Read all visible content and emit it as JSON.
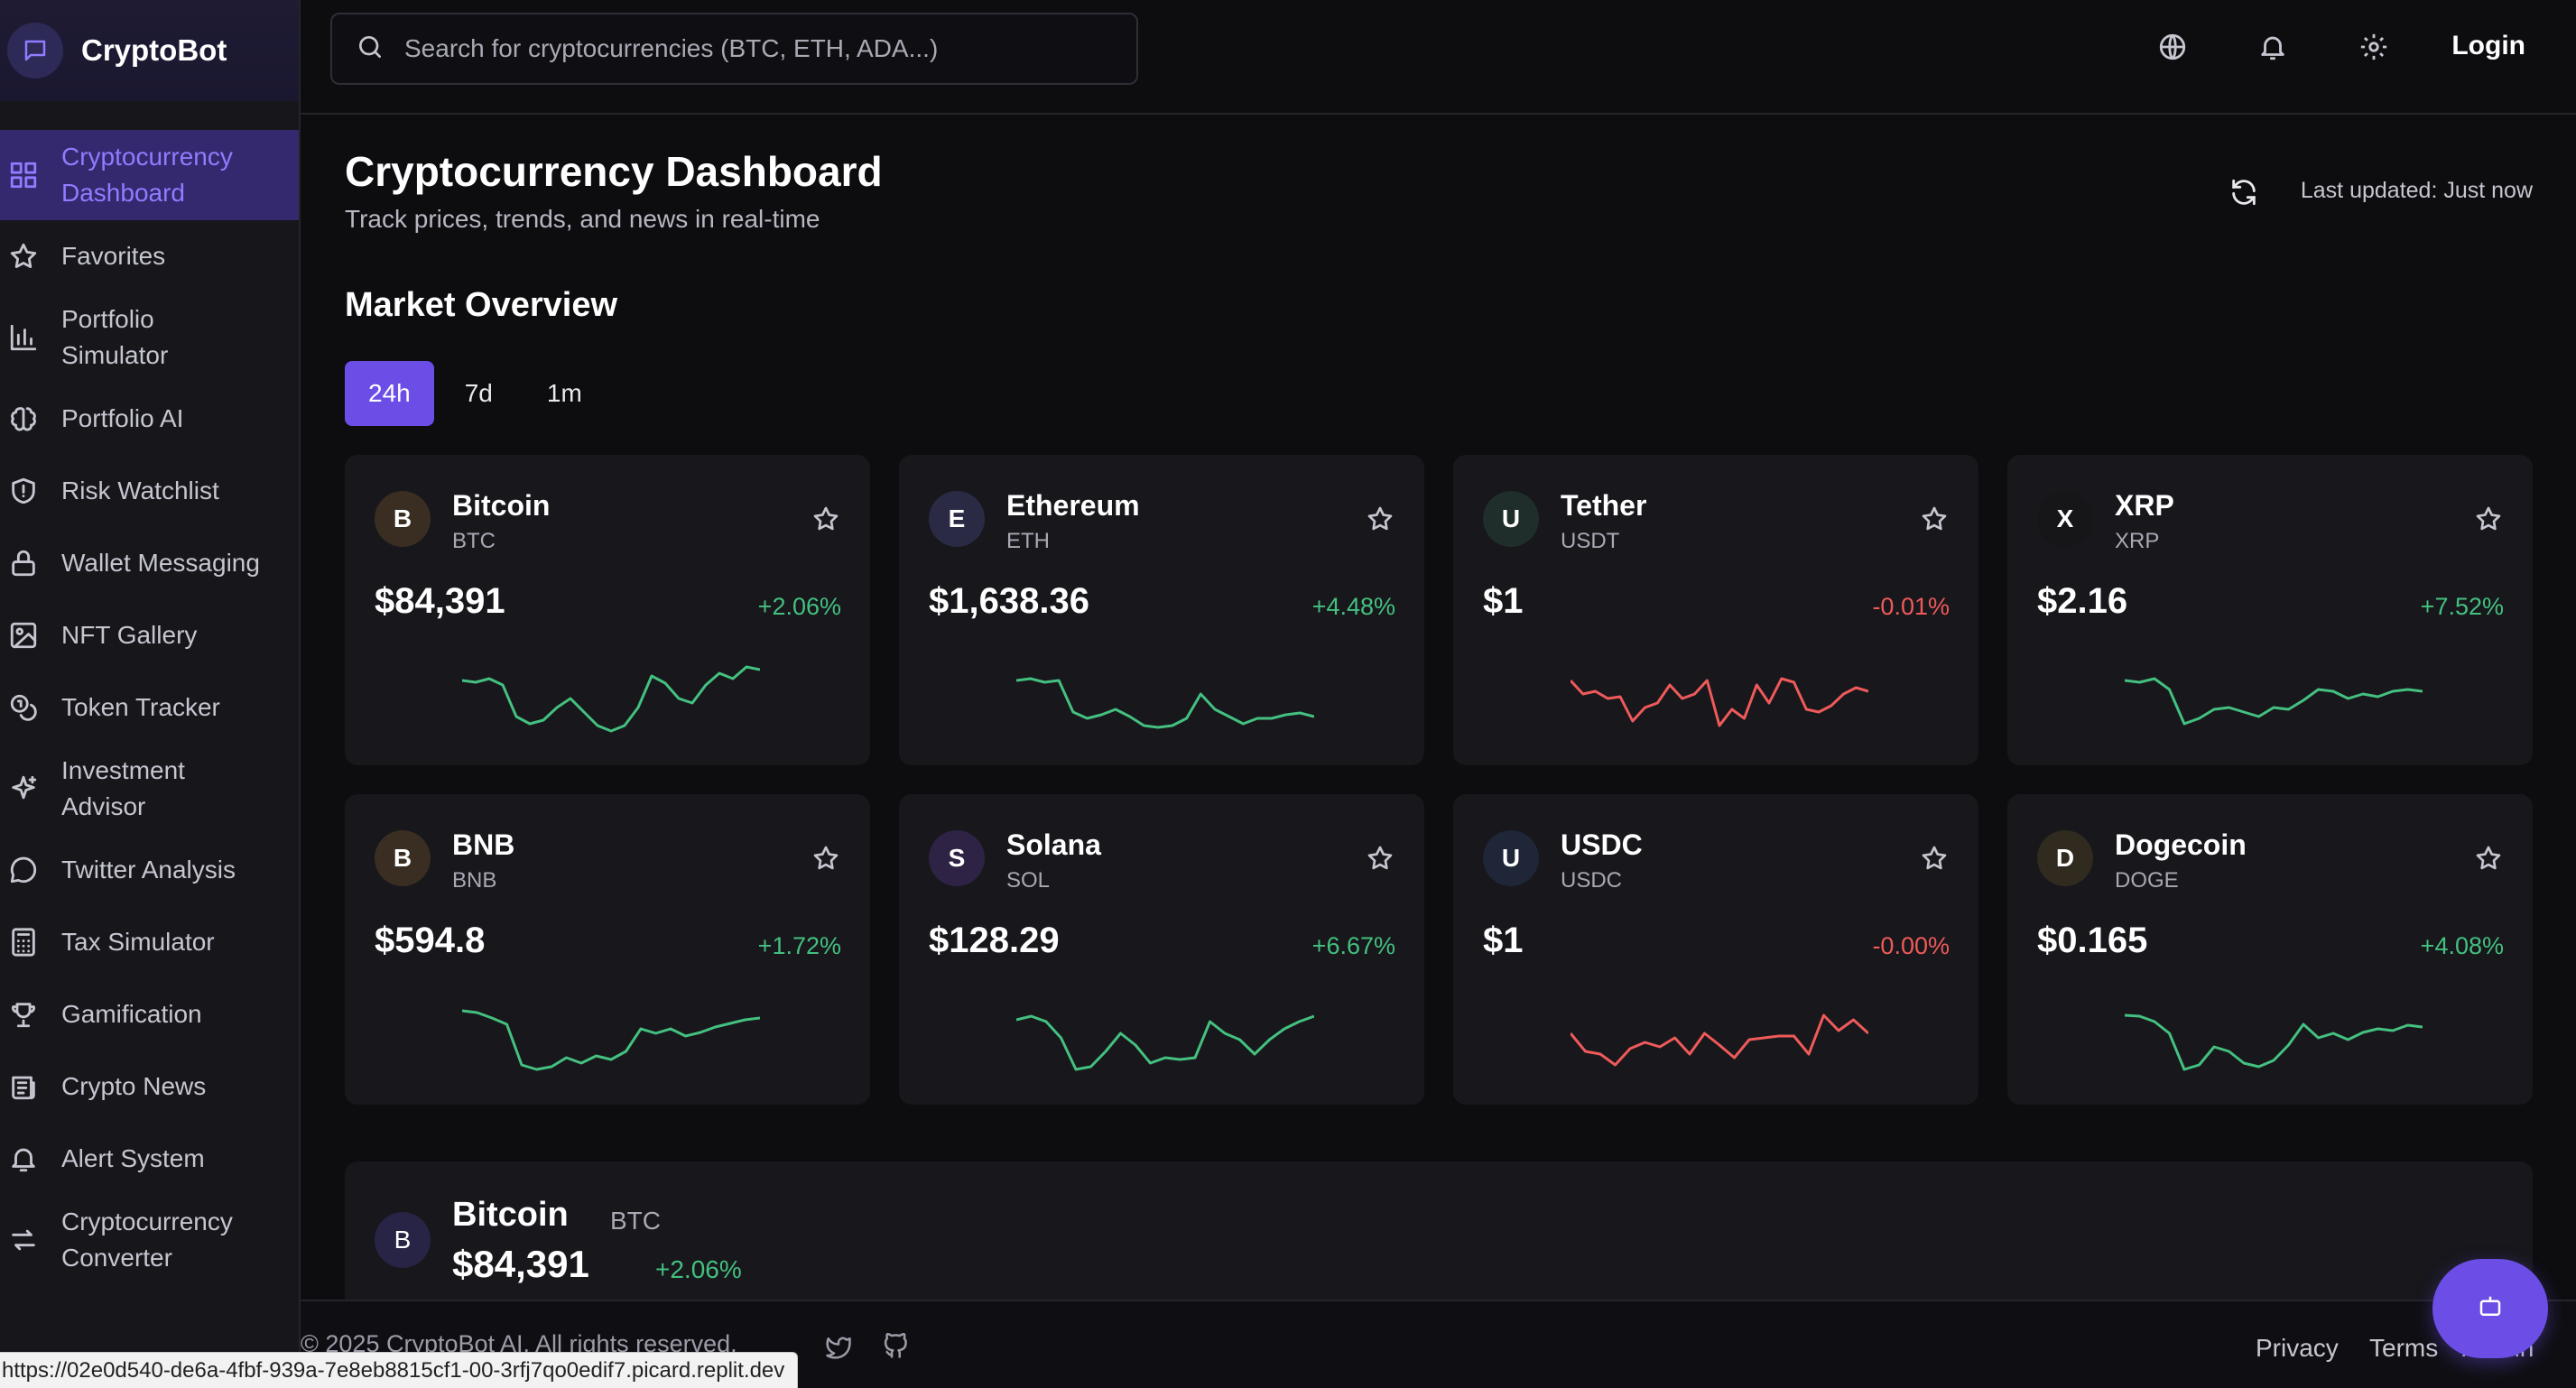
{
  "app": {
    "name": "CryptoBot",
    "brand_icon": "chat-bubble-icon"
  },
  "sidebar": {
    "items": [
      {
        "label": "Cryptocurrency\nDashboard",
        "icon": "grid-icon",
        "active": true
      },
      {
        "label": "Favorites",
        "icon": "star-icon"
      },
      {
        "label": "Portfolio\nSimulator",
        "icon": "bar-chart-icon"
      },
      {
        "label": "Portfolio AI",
        "icon": "brain-icon"
      },
      {
        "label": "Risk Watchlist",
        "icon": "shield-icon"
      },
      {
        "label": "Wallet Messaging",
        "icon": "lock-icon"
      },
      {
        "label": "NFT Gallery",
        "icon": "image-icon"
      },
      {
        "label": "Token Tracker",
        "icon": "coins-icon"
      },
      {
        "label": "Investment\nAdvisor",
        "icon": "sparkles-icon"
      },
      {
        "label": "Twitter Analysis",
        "icon": "message-circle-icon"
      },
      {
        "label": "Tax Simulator",
        "icon": "calculator-icon"
      },
      {
        "label": "Gamification",
        "icon": "trophy-icon"
      },
      {
        "label": "Crypto News",
        "icon": "newspaper-icon"
      },
      {
        "label": "Alert System",
        "icon": "bell-icon"
      },
      {
        "label": "Cryptocurrency\nConverter",
        "icon": "swap-icon"
      }
    ]
  },
  "topbar": {
    "search_placeholder": "Search for cryptocurrencies (BTC, ETH, ADA...)",
    "search_value": "",
    "login_label": "Login"
  },
  "header": {
    "title": "Cryptocurrency Dashboard",
    "subtitle": "Track prices, trends, and news in real-time",
    "last_updated": "Last updated: Just now"
  },
  "market": {
    "title": "Market Overview",
    "tabs": [
      {
        "label": "24h",
        "active": true
      },
      {
        "label": "7d",
        "active": false
      },
      {
        "label": "1m",
        "active": false
      }
    ],
    "coins": [
      {
        "letter": "B",
        "name": "Bitcoin",
        "symbol": "BTC",
        "price": "$84,391",
        "change": "+2.06%",
        "direction": "up",
        "avatar_color": "#3a2e22",
        "spark": [
          0.3,
          0.32,
          0.28,
          0.35,
          0.7,
          0.78,
          0.74,
          0.6,
          0.5,
          0.65,
          0.8,
          0.86,
          0.8,
          0.6,
          0.25,
          0.33,
          0.5,
          0.55,
          0.35,
          0.22,
          0.28,
          0.15,
          0.18
        ]
      },
      {
        "letter": "E",
        "name": "Ethereum",
        "symbol": "ETH",
        "price": "$1,638.36",
        "change": "+4.48%",
        "direction": "up",
        "avatar_color": "#2a2a45",
        "spark": [
          0.3,
          0.28,
          0.32,
          0.3,
          0.65,
          0.72,
          0.68,
          0.62,
          0.7,
          0.8,
          0.82,
          0.8,
          0.72,
          0.45,
          0.62,
          0.7,
          0.78,
          0.72,
          0.72,
          0.68,
          0.66,
          0.7
        ]
      },
      {
        "letter": "U",
        "name": "Tether",
        "symbol": "USDT",
        "price": "$1",
        "change": "-0.01%",
        "direction": "down",
        "avatar_color": "#1f2e2a",
        "spark": [
          0.3,
          0.45,
          0.42,
          0.5,
          0.48,
          0.75,
          0.6,
          0.55,
          0.35,
          0.5,
          0.45,
          0.3,
          0.8,
          0.62,
          0.72,
          0.35,
          0.55,
          0.28,
          0.32,
          0.62,
          0.65,
          0.58,
          0.45,
          0.38,
          0.42
        ]
      },
      {
        "letter": "X",
        "name": "XRP",
        "symbol": "XRP",
        "price": "$2.16",
        "change": "+7.52%",
        "direction": "up",
        "avatar_color": "#161619",
        "spark": [
          0.3,
          0.32,
          0.28,
          0.4,
          0.78,
          0.72,
          0.62,
          0.6,
          0.65,
          0.7,
          0.6,
          0.62,
          0.52,
          0.4,
          0.42,
          0.5,
          0.45,
          0.48,
          0.42,
          0.4,
          0.42
        ]
      }
    ],
    "coins_row2": [
      {
        "letter": "B",
        "name": "BNB",
        "symbol": "BNB",
        "price": "$594.8",
        "change": "+1.72%",
        "direction": "up",
        "avatar_color": "#3a2e22",
        "spark": [
          0.2,
          0.22,
          0.28,
          0.35,
          0.8,
          0.85,
          0.82,
          0.72,
          0.78,
          0.7,
          0.74,
          0.65,
          0.4,
          0.45,
          0.4,
          0.48,
          0.44,
          0.38,
          0.34,
          0.3,
          0.28
        ]
      },
      {
        "letter": "S",
        "name": "Solana",
        "symbol": "SOL",
        "price": "$128.29",
        "change": "+6.67%",
        "direction": "up",
        "avatar_color": "#2f2345",
        "spark": [
          0.3,
          0.26,
          0.32,
          0.5,
          0.85,
          0.82,
          0.65,
          0.45,
          0.58,
          0.78,
          0.72,
          0.74,
          0.72,
          0.32,
          0.45,
          0.52,
          0.68,
          0.52,
          0.4,
          0.32,
          0.26
        ]
      },
      {
        "letter": "U",
        "name": "USDC",
        "symbol": "USDC",
        "price": "$1",
        "change": "-0.00%",
        "direction": "down",
        "avatar_color": "#1f2638",
        "spark": [
          0.45,
          0.65,
          0.68,
          0.8,
          0.62,
          0.55,
          0.6,
          0.5,
          0.68,
          0.45,
          0.58,
          0.72,
          0.52,
          0.5,
          0.48,
          0.48,
          0.68,
          0.25,
          0.42,
          0.3,
          0.45
        ]
      },
      {
        "letter": "D",
        "name": "Dogecoin",
        "symbol": "DOGE",
        "price": "$0.165",
        "change": "+4.08%",
        "direction": "up",
        "avatar_color": "#302a1f",
        "spark": [
          0.25,
          0.26,
          0.32,
          0.45,
          0.85,
          0.8,
          0.6,
          0.65,
          0.78,
          0.82,
          0.75,
          0.58,
          0.35,
          0.5,
          0.45,
          0.52,
          0.44,
          0.4,
          0.42,
          0.36,
          0.38
        ]
      }
    ]
  },
  "detail": {
    "letter": "B",
    "name": "Bitcoin",
    "symbol": "BTC",
    "price": "$84,391",
    "change": "+2.06%"
  },
  "footer": {
    "copyright": "© 2025 CryptoBot AI. All rights reserved.",
    "links": [
      "Privacy",
      "Terms",
      "Admin"
    ]
  },
  "status_url": "https://02e0d540-de6a-4fbf-939a-7e8eb8815cf1-00-3rfj7qo0edif7.picard.replit.dev",
  "colors": {
    "accent": "#6c4ee6",
    "up": "#44c07f",
    "down": "#ef5a5a",
    "background": "#0d0d10",
    "card": "#17171c"
  }
}
